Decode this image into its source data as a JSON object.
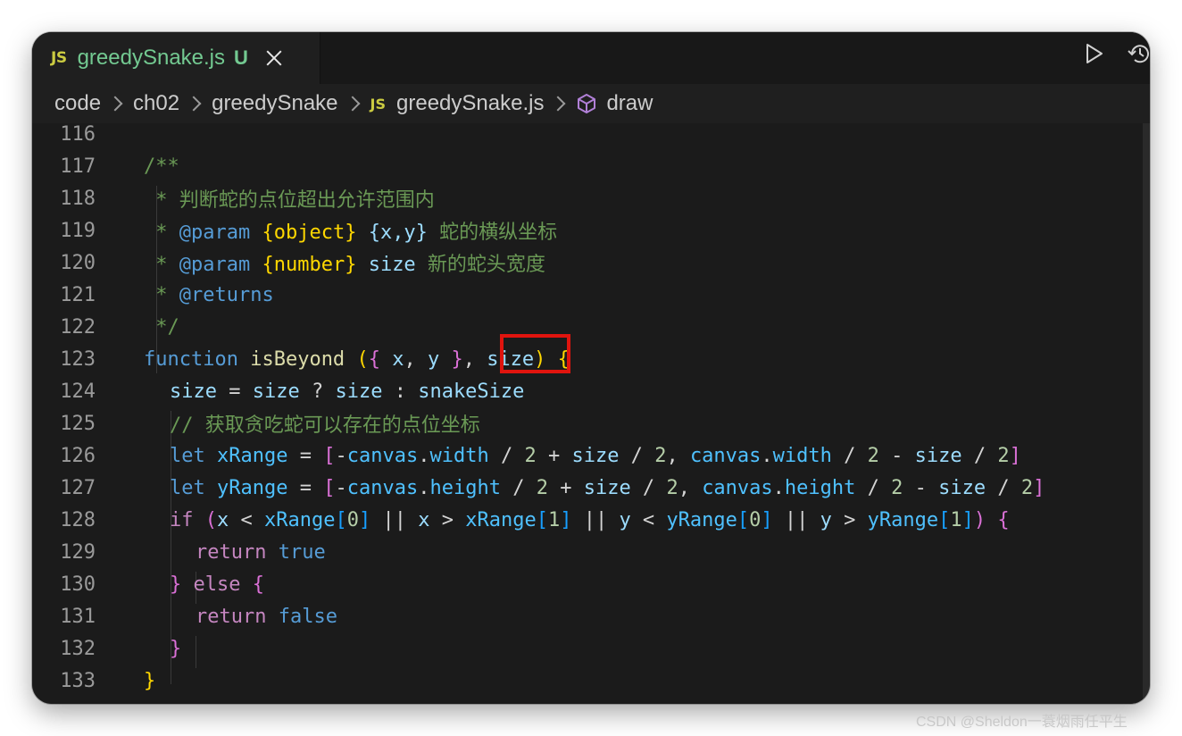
{
  "tab": {
    "language_badge": "JS",
    "file_name": "greedySnake.js",
    "status": "U"
  },
  "breadcrumb": {
    "items": [
      "code",
      "ch02",
      "greedySnake"
    ],
    "file_badge": "JS",
    "file": "greedySnake.js",
    "symbol": "draw"
  },
  "editor": {
    "line_numbers": [
      "116",
      "117",
      "118",
      "119",
      "120",
      "121",
      "122",
      "123",
      "124",
      "125",
      "126",
      "127",
      "128",
      "129",
      "130",
      "131",
      "132",
      "133"
    ],
    "lines": {
      "l117": "/**",
      "l118": " * 判断蛇的点位超出允许范围内",
      "l119a": " * ",
      "l119b": "@param",
      "l119c": " {object}",
      "l119d": " {x,y}",
      "l119e": " 蛇的横纵坐标",
      "l120a": " * ",
      "l120b": "@param",
      "l120c": " {number}",
      "l120d": " size",
      "l120e": " 新的蛇头宽度",
      "l121a": " * ",
      "l121b": "@returns",
      "l122": " */",
      "l123_kw": "function",
      "l123_fn": "isBeyond",
      "l123_p1": "x",
      "l123_p2": "y",
      "l123_p3": "size",
      "l124_a": "size",
      "l124_b": "size",
      "l124_c": "size",
      "l124_d": "snakeSize",
      "l125": "// 获取贪吃蛇可以存在的点位坐标",
      "l126_kw": "let",
      "l126_var": "xRange",
      "l126_c1": "canvas",
      "l126_p1": "width",
      "l126_c2": "canvas",
      "l126_p2": "width",
      "l127_kw": "let",
      "l127_var": "yRange",
      "l127_c1": "canvas",
      "l127_p1": "height",
      "l127_c2": "canvas",
      "l127_p2": "height",
      "l128_kw": "if",
      "l129_kw": "return",
      "l129_val": "true",
      "l130_kw": "else",
      "l131_kw": "return",
      "l131_val": "false"
    }
  },
  "watermark": "CSDN @Sheldon一蓑烟雨任平生",
  "colors": {
    "background": "#1b1b1b",
    "highlight_box": "#e0140e",
    "tab_text": "#73c991"
  }
}
